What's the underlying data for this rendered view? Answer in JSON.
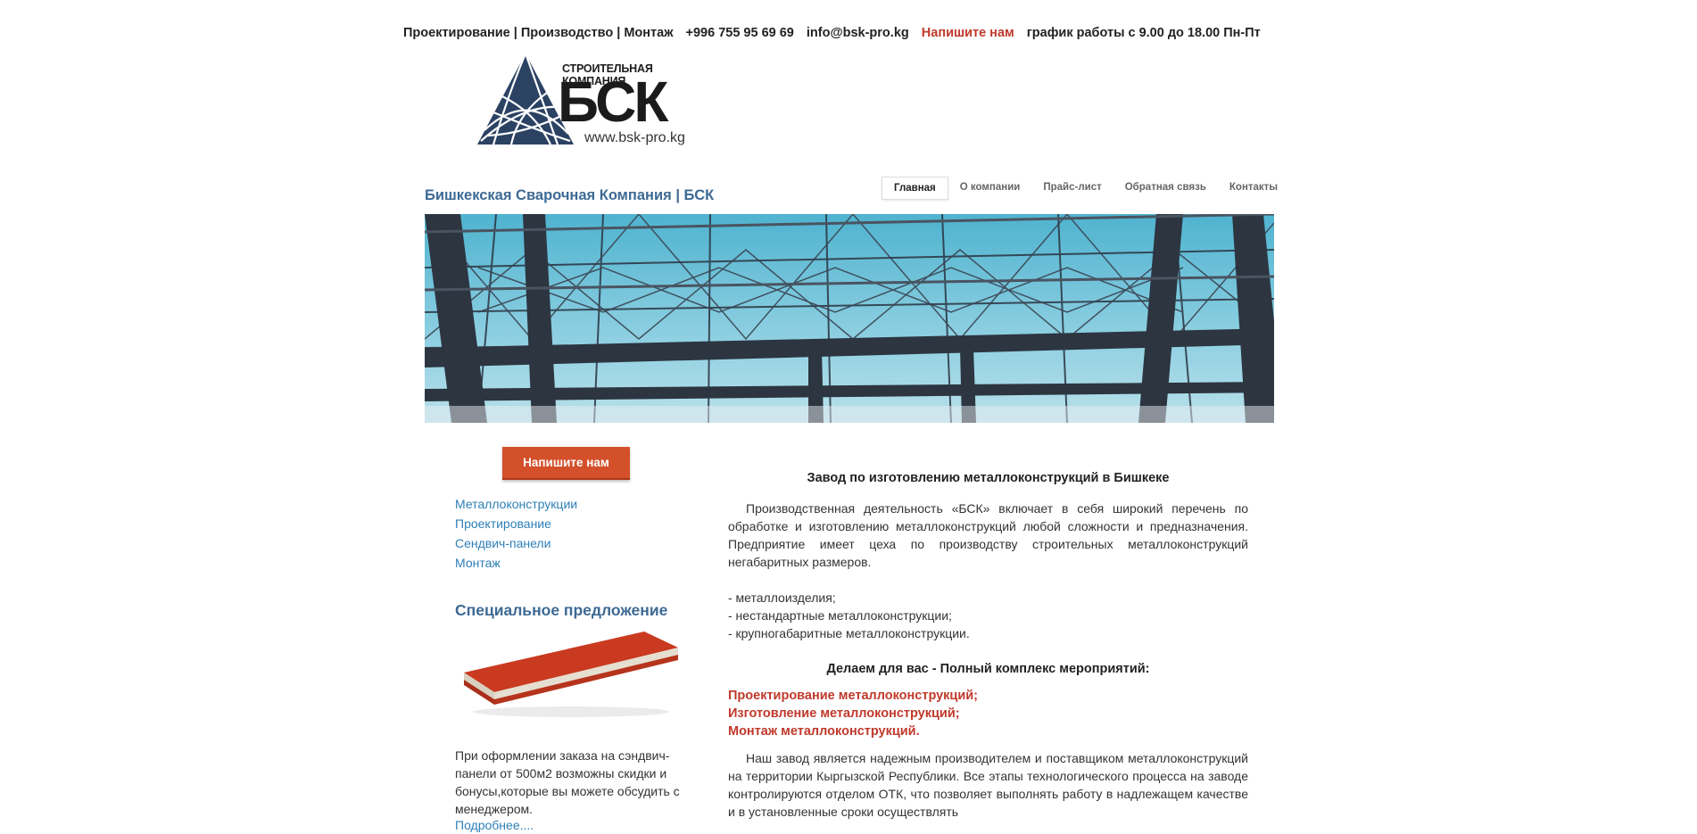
{
  "topbar": {
    "services": "Проектирование | Производство | Монтаж",
    "phone": "+996 755 95 69 69",
    "email": "info@bsk-pro.kg",
    "write_us": "Напишите нам",
    "hours": "график работы с 9.00 до 18.00 Пн-Пт"
  },
  "logo": {
    "tagline": "СТРОИТЕЛЬНАЯ КОМПАНИЯ",
    "name": "БСК",
    "url": "www.bsk-pro.kg"
  },
  "site_title": "Бишкекская Сварочная Компания | БСК",
  "nav": [
    {
      "label": "Главная",
      "active": true
    },
    {
      "label": "О компании"
    },
    {
      "label": "Прайс-лист"
    },
    {
      "label": "Обратная связь"
    },
    {
      "label": "Контакты"
    }
  ],
  "sidebar": {
    "write_button": "Напишите нам",
    "menu": [
      "Металлоконструкции",
      "Проектирование",
      "Сендвич-панели",
      "Монтаж"
    ],
    "special_title": "Специальное предложение",
    "special_text": "При оформлении заказа на сэндвич-панели от 500м2 возможны скидки и бонусы,которые вы можете обсудить с менеджером.",
    "more_link": "Подробнее...."
  },
  "content": {
    "heading": "Завод по изготовлению металлоконструкций в Бишкеке",
    "intro": "Производственная деятельность «БСК» включает в себя широкий перечень по обработке и изготовлению металлоконструкций любой сложности и предназначения. Предприятие имеет цеха по производству строительных металлоконструкций негабаритных размеров.",
    "list": [
      "- металлоизделия;",
      "- нестандартные металлоконструкции;",
      "- крупногабаритные металлоконструкции."
    ],
    "heading2": "Делаем для вас - Полный комплекс мероприятий:",
    "services": [
      "Проектирование металлоконструкций;",
      "Изготовление металлоконструкций;",
      "Монтаж металлоконструкций."
    ],
    "outro": "Наш завод является надежным производителем и поставщиком металлоконструкций на территории Кыргызской Республики. Все этапы технологического процесса на заводе контролируются отделом ОТК, что позволяет выполнять работу в надлежащем качестве и в установленные сроки осуществлять"
  },
  "colors": {
    "accent_red": "#c0392b",
    "button_red": "#d3502b",
    "title_blue": "#3d6a94",
    "link_blue": "#2d7fb8",
    "logo_navy": "#2b4263"
  }
}
